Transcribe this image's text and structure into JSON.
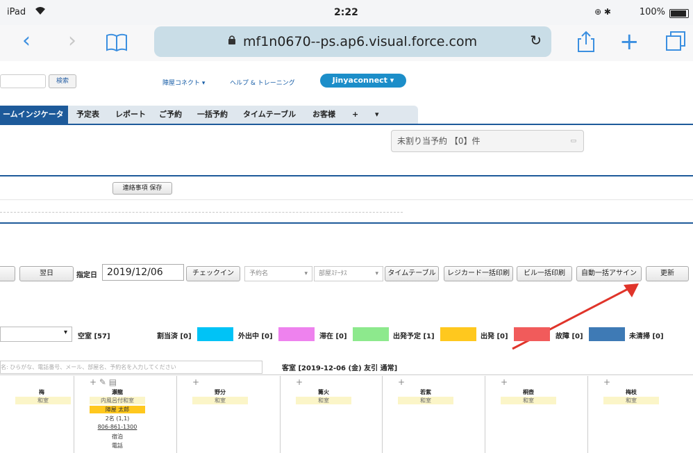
{
  "status_bar": {
    "device": "iPad",
    "time": "2:22",
    "battery": "100%"
  },
  "browser": {
    "url": "mf1n0670--ps.ap6.visual.force.com"
  },
  "header": {
    "search_button": "検索",
    "link_connect": "陣屋コネクト",
    "link_help": "ヘルプ & トレーニング",
    "user_menu": "Jinyaconnect"
  },
  "tabs": [
    "ームインジケータ",
    "予定表",
    "レポート",
    "ご予約",
    "一括予約",
    "タイムテーブル",
    "お客様",
    "+",
    "▾"
  ],
  "unassigned": "未割り当予約 【0】件",
  "save_notes": "連絡事項 保存",
  "controls": {
    "next_day": "翌日",
    "date_label": "指定日",
    "date_value": "2019/12/06",
    "checkin": "チェックイン",
    "reservation_name_placeholder": "予約名",
    "room_status_placeholder": "部屋ｽﾃｰﾀｽ",
    "timetable": "タイムテーブル",
    "reg_card_print": "レジカード一括印刷",
    "bill_print": "ビル一括印刷",
    "auto_assign": "自動一括アサイン",
    "refresh": "更新"
  },
  "legend": {
    "vacant": "空室 [57]",
    "assigned": "割当済 [0]",
    "out": "外出中 [0]",
    "staying": "滞在 [0]",
    "departing": "出発予定 [1]",
    "departed": "出発 [0]",
    "broken": "故障 [0]",
    "uncleaned": "未清掃 [0]",
    "colors": {
      "vacant": "#ffffff",
      "assigned": "#00c3f6",
      "out": "#ee82ee",
      "staying": "#8de98d",
      "departing": "#ffc81e",
      "departed": "#f15b5b",
      "broken": "#3e7ab5",
      "uncleaned": "#ffffff"
    }
  },
  "search_placeholder": "名: ひらがな、電話番号、メール、部屋名、予約名を入力してください",
  "room_header": "客室 [2019-12-06 (金) 友引 通常]",
  "rooms": [
    {
      "name": "梅",
      "type": "和室"
    },
    {
      "name": "瀬龍",
      "type": "内風呂付和室",
      "guest": "陣屋 太郎",
      "count": "2名 (1,1)",
      "phone": "806-861-1300",
      "plan": "宿泊",
      "memo": "電話"
    },
    {
      "name": "野分",
      "type": "和室"
    },
    {
      "name": "篝火",
      "type": "和室"
    },
    {
      "name": "若紫",
      "type": "和室"
    },
    {
      "name": "桐壺",
      "type": "和室"
    },
    {
      "name": "梅枝",
      "type": "和室"
    }
  ],
  "annotation_color": "#e0342a"
}
